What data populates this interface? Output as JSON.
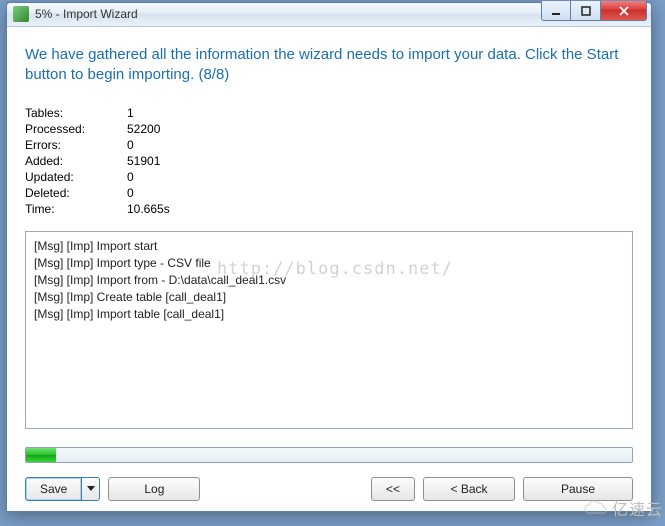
{
  "window": {
    "title": "5% - Import Wizard"
  },
  "heading": "We have gathered all the information the wizard needs to import your data. Click the Start button to begin importing. (8/8)",
  "stats": {
    "labels": {
      "tables": "Tables:",
      "processed": "Processed:",
      "errors": "Errors:",
      "added": "Added:",
      "updated": "Updated:",
      "deleted": "Deleted:",
      "time": "Time:"
    },
    "values": {
      "tables": "1",
      "processed": "52200",
      "errors": "0",
      "added": "51901",
      "updated": "0",
      "deleted": "0",
      "time": "10.665s"
    }
  },
  "log": [
    "[Msg] [Imp] Import start",
    "[Msg] [Imp] Import type - CSV file",
    "[Msg] [Imp] Import from - D:\\data\\call_deal1.csv",
    "[Msg] [Imp] Create table [call_deal1]",
    "[Msg] [Imp] Import table [call_deal1]"
  ],
  "progress_percent": 5,
  "buttons": {
    "save": "Save",
    "log": "Log",
    "prev": "<<",
    "back": "< Back",
    "pause": "Pause"
  },
  "bg_watermark": "http://blog.csdn.net/",
  "corner_watermark": "亿速云"
}
